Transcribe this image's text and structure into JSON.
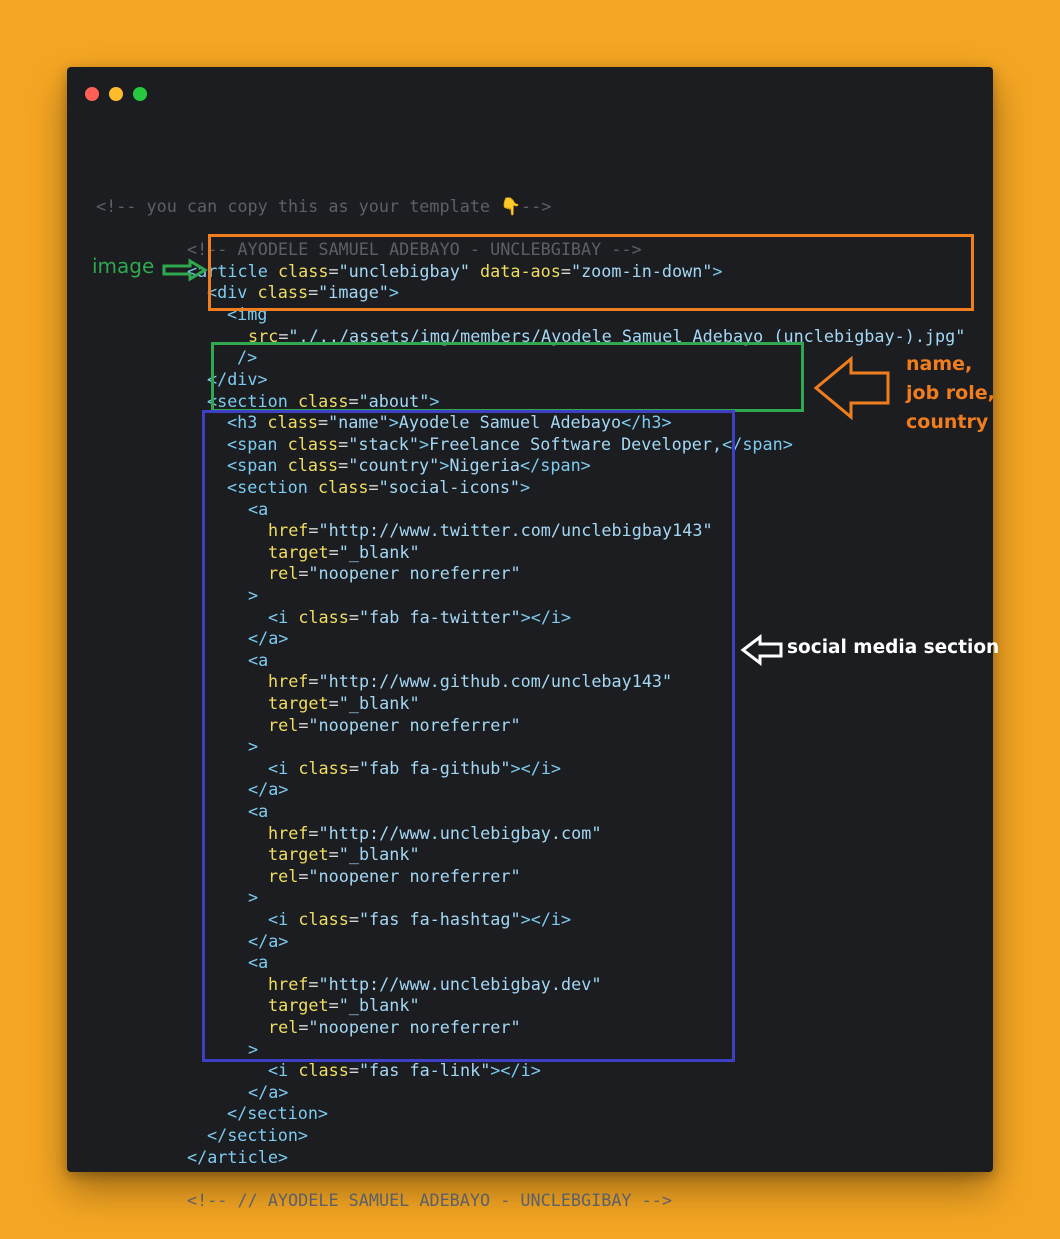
{
  "window": {
    "controls": [
      "close",
      "minimize",
      "maximize"
    ],
    "colors": {
      "close": "#ff5f56",
      "minimize": "#ffbd2e",
      "maximize": "#27c93f"
    }
  },
  "code_lines": [
    [
      [
        "cmt",
        "<!-- you can copy this as your template "
      ],
      [
        "hand",
        "👇"
      ],
      [
        "cmt",
        "-->"
      ]
    ],
    [
      [
        "cmt",
        "<!-- AYODELE SAMUEL ADEBAYO - UNCLEBGIBAY -->"
      ]
    ],
    [
      [
        "tag",
        "<article "
      ],
      [
        "attr",
        "class"
      ],
      [
        "eq",
        "="
      ],
      [
        "str",
        "\"unclebigbay\""
      ],
      [
        "attr",
        " data-aos"
      ],
      [
        "eq",
        "="
      ],
      [
        "str",
        "\"zoom-in-down\""
      ],
      [
        "tag",
        ">"
      ]
    ],
    [
      [
        "tag",
        "<div "
      ],
      [
        "attr",
        "class"
      ],
      [
        "eq",
        "="
      ],
      [
        "str",
        "\"image\""
      ],
      [
        "tag",
        ">"
      ]
    ],
    [
      [
        "tag",
        "<img"
      ]
    ],
    [
      [
        "attr",
        "src"
      ],
      [
        "eq",
        "="
      ],
      [
        "str",
        "\"./../assets/img/members/Ayodele Samuel Adebayo (unclebigbay-).jpg\""
      ]
    ],
    [
      [
        "tag",
        "/>"
      ]
    ],
    [
      [
        "tag",
        "</div>"
      ]
    ],
    [
      [
        "tag",
        "<section "
      ],
      [
        "attr",
        "class"
      ],
      [
        "eq",
        "="
      ],
      [
        "str",
        "\"about\""
      ],
      [
        "tag",
        ">"
      ]
    ],
    [
      [
        "tag",
        "<h3 "
      ],
      [
        "attr",
        "class"
      ],
      [
        "eq",
        "="
      ],
      [
        "str",
        "\"name\""
      ],
      [
        "tag",
        ">"
      ],
      [
        "txt",
        "Ayodele Samuel Adebayo"
      ],
      [
        "tag",
        "</h3>"
      ]
    ],
    [
      [
        "tag",
        "<span "
      ],
      [
        "attr",
        "class"
      ],
      [
        "eq",
        "="
      ],
      [
        "str",
        "\"stack\""
      ],
      [
        "tag",
        ">"
      ],
      [
        "txt",
        "Freelance Software Developer,"
      ],
      [
        "tag",
        "</span>"
      ]
    ],
    [
      [
        "tag",
        "<span "
      ],
      [
        "attr",
        "class"
      ],
      [
        "eq",
        "="
      ],
      [
        "str",
        "\"country\""
      ],
      [
        "tag",
        ">"
      ],
      [
        "txt",
        "Nigeria"
      ],
      [
        "tag",
        "</span>"
      ]
    ],
    [
      [
        "tag",
        "<section "
      ],
      [
        "attr",
        "class"
      ],
      [
        "eq",
        "="
      ],
      [
        "str",
        "\"social-icons\""
      ],
      [
        "tag",
        ">"
      ]
    ],
    [
      [
        "tag",
        "<a"
      ]
    ],
    [
      [
        "attr",
        "href"
      ],
      [
        "eq",
        "="
      ],
      [
        "str",
        "\"http://www.twitter.com/unclebigbay143\""
      ]
    ],
    [
      [
        "attr",
        "target"
      ],
      [
        "eq",
        "="
      ],
      [
        "str",
        "\"_blank\""
      ]
    ],
    [
      [
        "attr",
        "rel"
      ],
      [
        "eq",
        "="
      ],
      [
        "str",
        "\"noopener noreferrer\""
      ]
    ],
    [
      [
        "tag",
        ">"
      ]
    ],
    [
      [
        "tag",
        "<i "
      ],
      [
        "attr",
        "class"
      ],
      [
        "eq",
        "="
      ],
      [
        "str",
        "\"fab fa-twitter\""
      ],
      [
        "tag",
        "></i>"
      ]
    ],
    [
      [
        "tag",
        "</a>"
      ]
    ],
    [
      [
        "tag",
        "<a"
      ]
    ],
    [
      [
        "attr",
        "href"
      ],
      [
        "eq",
        "="
      ],
      [
        "str",
        "\"http://www.github.com/unclebay143\""
      ]
    ],
    [
      [
        "attr",
        "target"
      ],
      [
        "eq",
        "="
      ],
      [
        "str",
        "\"_blank\""
      ]
    ],
    [
      [
        "attr",
        "rel"
      ],
      [
        "eq",
        "="
      ],
      [
        "str",
        "\"noopener noreferrer\""
      ]
    ],
    [
      [
        "tag",
        ">"
      ]
    ],
    [
      [
        "tag",
        "<i "
      ],
      [
        "attr",
        "class"
      ],
      [
        "eq",
        "="
      ],
      [
        "str",
        "\"fab fa-github\""
      ],
      [
        "tag",
        "></i>"
      ]
    ],
    [
      [
        "tag",
        "</a>"
      ]
    ],
    [
      [
        "tag",
        "<a"
      ]
    ],
    [
      [
        "attr",
        "href"
      ],
      [
        "eq",
        "="
      ],
      [
        "str",
        "\"http://www.unclebigbay.com\""
      ]
    ],
    [
      [
        "attr",
        "target"
      ],
      [
        "eq",
        "="
      ],
      [
        "str",
        "\"_blank\""
      ]
    ],
    [
      [
        "attr",
        "rel"
      ],
      [
        "eq",
        "="
      ],
      [
        "str",
        "\"noopener noreferrer\""
      ]
    ],
    [
      [
        "tag",
        ">"
      ]
    ],
    [
      [
        "tag",
        "<i "
      ],
      [
        "attr",
        "class"
      ],
      [
        "eq",
        "="
      ],
      [
        "str",
        "\"fas fa-hashtag\""
      ],
      [
        "tag",
        "></i>"
      ]
    ],
    [
      [
        "tag",
        "</a>"
      ]
    ],
    [
      [
        "tag",
        "<a"
      ]
    ],
    [
      [
        "attr",
        "href"
      ],
      [
        "eq",
        "="
      ],
      [
        "str",
        "\"http://www.unclebigbay.dev\""
      ]
    ],
    [
      [
        "attr",
        "target"
      ],
      [
        "eq",
        "="
      ],
      [
        "str",
        "\"_blank\""
      ]
    ],
    [
      [
        "attr",
        "rel"
      ],
      [
        "eq",
        "="
      ],
      [
        "str",
        "\"noopener noreferrer\""
      ]
    ],
    [
      [
        "tag",
        ">"
      ]
    ],
    [
      [
        "tag",
        "<i "
      ],
      [
        "attr",
        "class"
      ],
      [
        "eq",
        "="
      ],
      [
        "str",
        "\"fas fa-link\""
      ],
      [
        "tag",
        "></i>"
      ]
    ],
    [
      [
        "tag",
        "</a>"
      ]
    ],
    [
      [
        "tag",
        "</section>"
      ]
    ],
    [
      [
        "tag",
        "</section>"
      ]
    ],
    [
      [
        "tag",
        "</article>"
      ]
    ],
    [
      [
        "cmt",
        "<!-- // AYODELE SAMUEL ADEBAYO - UNCLEBGIBAY -->"
      ]
    ]
  ],
  "annotations": {
    "image_label": "image",
    "name_label_lines": [
      "name,",
      "job role,",
      "country"
    ],
    "social_label": "social media section"
  },
  "colors": {
    "background": "#f5a623",
    "editor": "#1b1d20",
    "image_box": "#f07d1e",
    "name_box": "#2fa84f",
    "social_box": "#3d3fc4"
  }
}
